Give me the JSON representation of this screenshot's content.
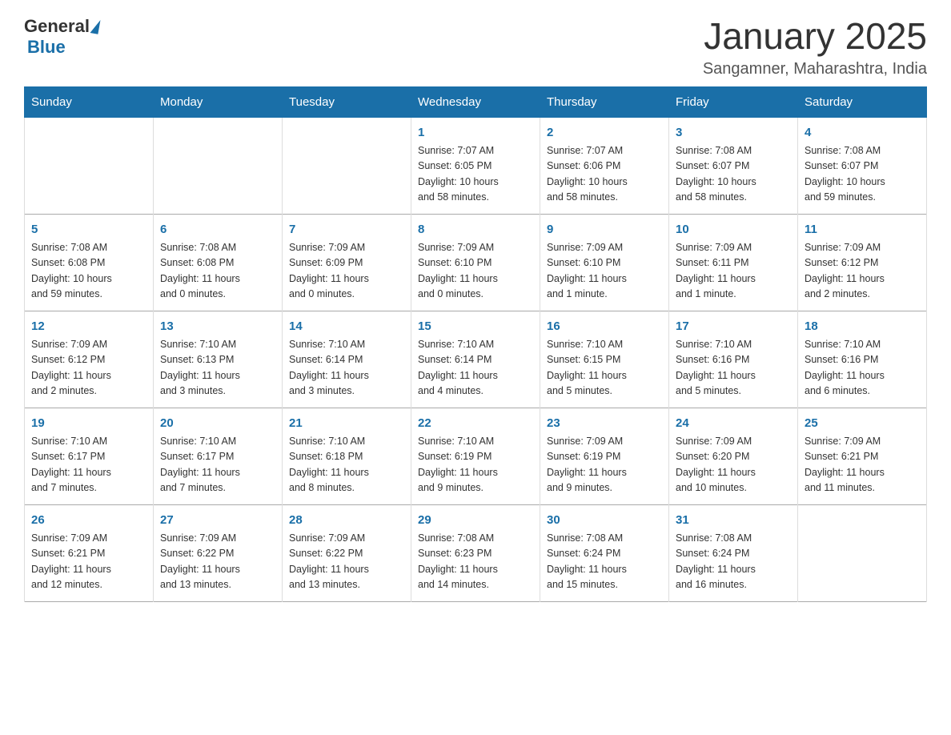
{
  "header": {
    "logo_general": "General",
    "logo_blue": "Blue",
    "month_title": "January 2025",
    "location": "Sangamner, Maharashtra, India"
  },
  "days_of_week": [
    "Sunday",
    "Monday",
    "Tuesday",
    "Wednesday",
    "Thursday",
    "Friday",
    "Saturday"
  ],
  "weeks": [
    [
      {
        "day": "",
        "info": ""
      },
      {
        "day": "",
        "info": ""
      },
      {
        "day": "",
        "info": ""
      },
      {
        "day": "1",
        "info": "Sunrise: 7:07 AM\nSunset: 6:05 PM\nDaylight: 10 hours\nand 58 minutes."
      },
      {
        "day": "2",
        "info": "Sunrise: 7:07 AM\nSunset: 6:06 PM\nDaylight: 10 hours\nand 58 minutes."
      },
      {
        "day": "3",
        "info": "Sunrise: 7:08 AM\nSunset: 6:07 PM\nDaylight: 10 hours\nand 58 minutes."
      },
      {
        "day": "4",
        "info": "Sunrise: 7:08 AM\nSunset: 6:07 PM\nDaylight: 10 hours\nand 59 minutes."
      }
    ],
    [
      {
        "day": "5",
        "info": "Sunrise: 7:08 AM\nSunset: 6:08 PM\nDaylight: 10 hours\nand 59 minutes."
      },
      {
        "day": "6",
        "info": "Sunrise: 7:08 AM\nSunset: 6:08 PM\nDaylight: 11 hours\nand 0 minutes."
      },
      {
        "day": "7",
        "info": "Sunrise: 7:09 AM\nSunset: 6:09 PM\nDaylight: 11 hours\nand 0 minutes."
      },
      {
        "day": "8",
        "info": "Sunrise: 7:09 AM\nSunset: 6:10 PM\nDaylight: 11 hours\nand 0 minutes."
      },
      {
        "day": "9",
        "info": "Sunrise: 7:09 AM\nSunset: 6:10 PM\nDaylight: 11 hours\nand 1 minute."
      },
      {
        "day": "10",
        "info": "Sunrise: 7:09 AM\nSunset: 6:11 PM\nDaylight: 11 hours\nand 1 minute."
      },
      {
        "day": "11",
        "info": "Sunrise: 7:09 AM\nSunset: 6:12 PM\nDaylight: 11 hours\nand 2 minutes."
      }
    ],
    [
      {
        "day": "12",
        "info": "Sunrise: 7:09 AM\nSunset: 6:12 PM\nDaylight: 11 hours\nand 2 minutes."
      },
      {
        "day": "13",
        "info": "Sunrise: 7:10 AM\nSunset: 6:13 PM\nDaylight: 11 hours\nand 3 minutes."
      },
      {
        "day": "14",
        "info": "Sunrise: 7:10 AM\nSunset: 6:14 PM\nDaylight: 11 hours\nand 3 minutes."
      },
      {
        "day": "15",
        "info": "Sunrise: 7:10 AM\nSunset: 6:14 PM\nDaylight: 11 hours\nand 4 minutes."
      },
      {
        "day": "16",
        "info": "Sunrise: 7:10 AM\nSunset: 6:15 PM\nDaylight: 11 hours\nand 5 minutes."
      },
      {
        "day": "17",
        "info": "Sunrise: 7:10 AM\nSunset: 6:16 PM\nDaylight: 11 hours\nand 5 minutes."
      },
      {
        "day": "18",
        "info": "Sunrise: 7:10 AM\nSunset: 6:16 PM\nDaylight: 11 hours\nand 6 minutes."
      }
    ],
    [
      {
        "day": "19",
        "info": "Sunrise: 7:10 AM\nSunset: 6:17 PM\nDaylight: 11 hours\nand 7 minutes."
      },
      {
        "day": "20",
        "info": "Sunrise: 7:10 AM\nSunset: 6:17 PM\nDaylight: 11 hours\nand 7 minutes."
      },
      {
        "day": "21",
        "info": "Sunrise: 7:10 AM\nSunset: 6:18 PM\nDaylight: 11 hours\nand 8 minutes."
      },
      {
        "day": "22",
        "info": "Sunrise: 7:10 AM\nSunset: 6:19 PM\nDaylight: 11 hours\nand 9 minutes."
      },
      {
        "day": "23",
        "info": "Sunrise: 7:09 AM\nSunset: 6:19 PM\nDaylight: 11 hours\nand 9 minutes."
      },
      {
        "day": "24",
        "info": "Sunrise: 7:09 AM\nSunset: 6:20 PM\nDaylight: 11 hours\nand 10 minutes."
      },
      {
        "day": "25",
        "info": "Sunrise: 7:09 AM\nSunset: 6:21 PM\nDaylight: 11 hours\nand 11 minutes."
      }
    ],
    [
      {
        "day": "26",
        "info": "Sunrise: 7:09 AM\nSunset: 6:21 PM\nDaylight: 11 hours\nand 12 minutes."
      },
      {
        "day": "27",
        "info": "Sunrise: 7:09 AM\nSunset: 6:22 PM\nDaylight: 11 hours\nand 13 minutes."
      },
      {
        "day": "28",
        "info": "Sunrise: 7:09 AM\nSunset: 6:22 PM\nDaylight: 11 hours\nand 13 minutes."
      },
      {
        "day": "29",
        "info": "Sunrise: 7:08 AM\nSunset: 6:23 PM\nDaylight: 11 hours\nand 14 minutes."
      },
      {
        "day": "30",
        "info": "Sunrise: 7:08 AM\nSunset: 6:24 PM\nDaylight: 11 hours\nand 15 minutes."
      },
      {
        "day": "31",
        "info": "Sunrise: 7:08 AM\nSunset: 6:24 PM\nDaylight: 11 hours\nand 16 minutes."
      },
      {
        "day": "",
        "info": ""
      }
    ]
  ]
}
